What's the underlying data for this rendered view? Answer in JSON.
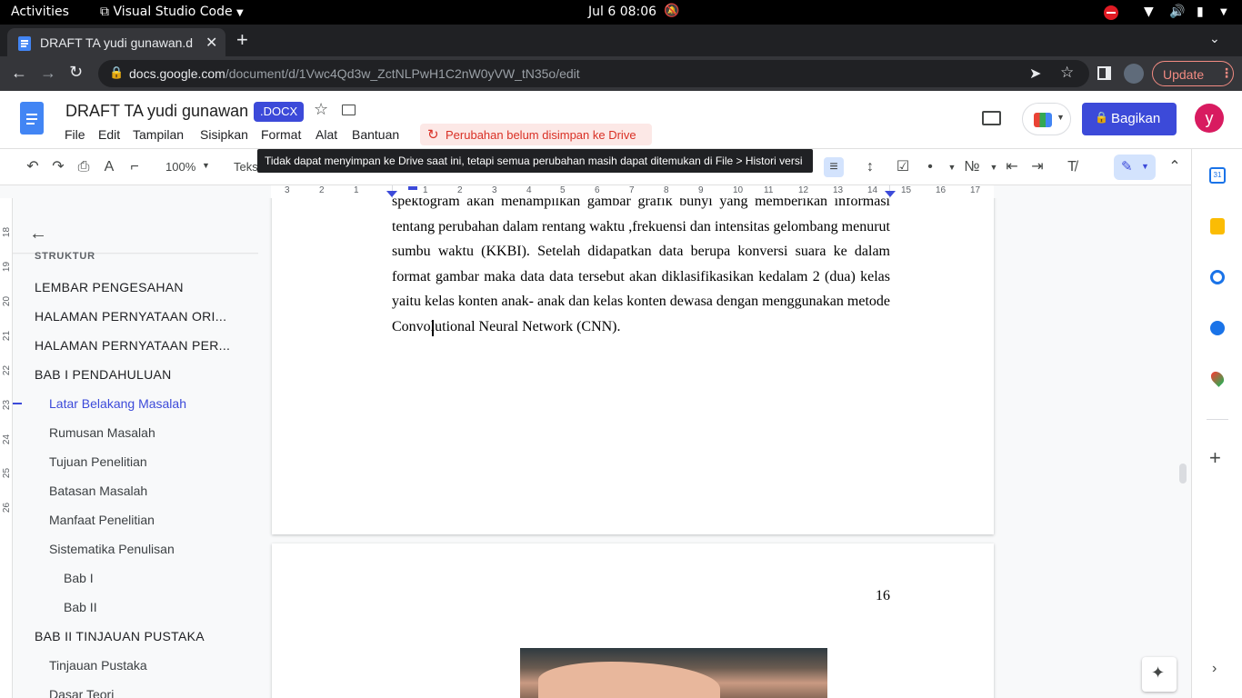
{
  "system_bar": {
    "activities": "Activities",
    "app_name": "Visual Studio Code",
    "clock": "Jul 6  08:06"
  },
  "browser": {
    "tab_title": "DRAFT TA yudi gunawan.d",
    "url_domain": "docs.google.com",
    "url_path": "/document/d/1Vwc4Qd3w_ZctNLPwH1C2nW0yVW_tN35o/edit",
    "update_label": "Update"
  },
  "docs": {
    "title": "DRAFT TA yudi gunawan",
    "format_badge": ".DOCX",
    "menu": [
      "File",
      "Edit",
      "Tampilan",
      "Sisipkan",
      "Format",
      "Alat",
      "Bantuan"
    ],
    "save_status": "Perubahan belum disimpan ke Drive",
    "tooltip": "Tidak dapat menyimpan ke Drive saat ini, tetapi semua perubahan masih dapat ditemukan di File > Histori versi",
    "share_label": "Bagikan",
    "avatar_letter": "y",
    "zoom": "100%",
    "style_label": "Teks"
  },
  "outline": {
    "section_label": "STRUKTUR",
    "items": [
      {
        "label": "LEMBAR PENGESAHAN",
        "level": 1
      },
      {
        "label": "HALAMAN PERNYATAAN ORI...",
        "level": 1
      },
      {
        "label": "HALAMAN PERNYATAAN PER...",
        "level": 1
      },
      {
        "label": "BAB I PENDAHULUAN",
        "level": 1
      },
      {
        "label": "Latar Belakang Masalah",
        "level": 2,
        "active": true
      },
      {
        "label": "Rumusan Masalah",
        "level": 2
      },
      {
        "label": "Tujuan Penelitian",
        "level": 2
      },
      {
        "label": "Batasan Masalah",
        "level": 2
      },
      {
        "label": "Manfaat Penelitian",
        "level": 2
      },
      {
        "label": "Sistematika Penulisan",
        "level": 2
      },
      {
        "label": "Bab I",
        "level": 3
      },
      {
        "label": "Bab II",
        "level": 3
      },
      {
        "label": "BAB II TINJAUAN PUSTAKA",
        "level": 1
      },
      {
        "label": "Tinjauan Pustaka",
        "level": 2
      },
      {
        "label": "Dasar Teori",
        "level": 2
      }
    ]
  },
  "document": {
    "lines": [
      "spektogram akan menampilkan gambar grafik bunyi yang memberikan informasi",
      "tentang perubahan dalam rentang waktu ,frekuensi dan intensitas gelombang menurut",
      "sumbu waktu (KKBI). Setelah didapatkan data berupa konversi suara ke dalam",
      "format gambar maka data data tersebut akan diklasifikasikan kedalam 2 (dua) kelas",
      "yaitu kelas konten anak- anak dan kelas konten dewasa dengan menggunakan metode",
      "Convolutional Neural Network (CNN)."
    ],
    "page_number": "16"
  },
  "ruler": {
    "numbers": [
      "3",
      "2",
      "1",
      "1",
      "2",
      "3",
      "4",
      "5",
      "6",
      "7",
      "8",
      "9",
      "10",
      "11",
      "12",
      "13",
      "14",
      "15",
      "16",
      "17"
    ],
    "vertical_numbers": [
      "18",
      "19",
      "20",
      "21",
      "22",
      "23",
      "24",
      "25",
      "26"
    ]
  },
  "colors": {
    "accent": "#1a73e8",
    "share_button": "#3c4ad9",
    "avatar": "#d81b60",
    "error": "#d93025",
    "outline_active": "#3c4ad9",
    "badge": "#3c4ad9"
  }
}
